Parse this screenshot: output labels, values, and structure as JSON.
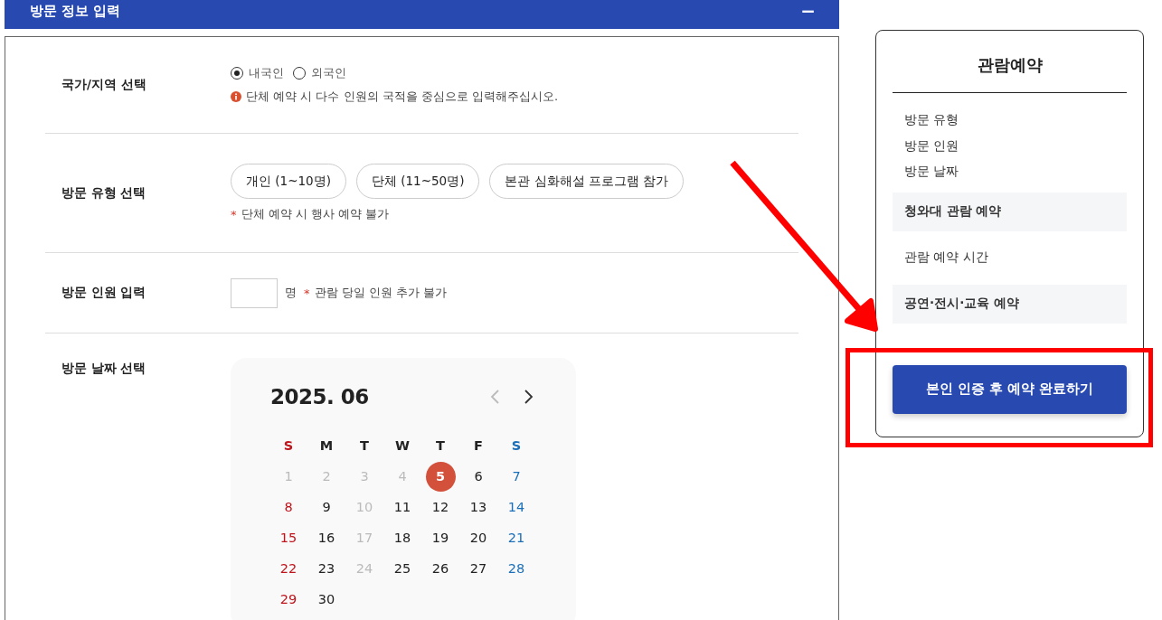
{
  "section": {
    "title": "방문 정보 입력",
    "collapse_icon": "−"
  },
  "form": {
    "rows": [
      {
        "kind": "radio",
        "label": "국가/지역 선택",
        "options": [
          {
            "label": "내국인",
            "selected": true
          },
          {
            "label": "외국인",
            "selected": false
          }
        ],
        "note": "단체 예약 시 다수 인원의 국적을 중심으로 입력해주십시오."
      },
      {
        "kind": "chips",
        "label": "방문 유형 선택",
        "options": [
          {
            "label": "개인 (1~10명)",
            "selected": false
          },
          {
            "label": "단체 (11~50명)",
            "selected": false
          },
          {
            "label": "본관 심화해설 프로그램 참가",
            "selected": false
          }
        ],
        "note_mark": "*",
        "note": "단체 예약 시 행사 예약 불가"
      },
      {
        "kind": "count",
        "label": "방문 인원 입력",
        "unit": "명",
        "note_mark": "*",
        "note": "관람 당일 인원 추가 불가"
      },
      {
        "kind": "calendar",
        "label": "방문 날짜 선택"
      }
    ]
  },
  "calendar": {
    "month": "2025. 06",
    "weekdays": [
      {
        "label": "S",
        "kind": "sun"
      },
      {
        "label": "M",
        "kind": "normal"
      },
      {
        "label": "T",
        "kind": "normal"
      },
      {
        "label": "W",
        "kind": "normal"
      },
      {
        "label": "T",
        "kind": "normal"
      },
      {
        "label": "F",
        "kind": "normal"
      },
      {
        "label": "S",
        "kind": "sat"
      }
    ],
    "weeks": [
      [
        {
          "day": "1",
          "kind": "disabled",
          "selected": false
        },
        {
          "day": "2",
          "kind": "disabled",
          "selected": false
        },
        {
          "day": "3",
          "kind": "disabled",
          "selected": false
        },
        {
          "day": "4",
          "kind": "disabled",
          "selected": false
        },
        {
          "day": "5",
          "kind": "normal",
          "selected": true
        },
        {
          "day": "6",
          "kind": "normal",
          "selected": false
        },
        {
          "day": "7",
          "kind": "sat",
          "selected": false
        }
      ],
      [
        {
          "day": "8",
          "kind": "sun",
          "selected": false
        },
        {
          "day": "9",
          "kind": "normal",
          "selected": false
        },
        {
          "day": "10",
          "kind": "disabled",
          "selected": false
        },
        {
          "day": "11",
          "kind": "normal",
          "selected": false
        },
        {
          "day": "12",
          "kind": "normal",
          "selected": false
        },
        {
          "day": "13",
          "kind": "normal",
          "selected": false
        },
        {
          "day": "14",
          "kind": "sat",
          "selected": false
        }
      ],
      [
        {
          "day": "15",
          "kind": "sun",
          "selected": false
        },
        {
          "day": "16",
          "kind": "normal",
          "selected": false
        },
        {
          "day": "17",
          "kind": "disabled",
          "selected": false
        },
        {
          "day": "18",
          "kind": "normal",
          "selected": false
        },
        {
          "day": "19",
          "kind": "normal",
          "selected": false
        },
        {
          "day": "20",
          "kind": "normal",
          "selected": false
        },
        {
          "day": "21",
          "kind": "sat",
          "selected": false
        }
      ],
      [
        {
          "day": "22",
          "kind": "sun",
          "selected": false
        },
        {
          "day": "23",
          "kind": "normal",
          "selected": false
        },
        {
          "day": "24",
          "kind": "disabled",
          "selected": false
        },
        {
          "day": "25",
          "kind": "normal",
          "selected": false
        },
        {
          "day": "26",
          "kind": "normal",
          "selected": false
        },
        {
          "day": "27",
          "kind": "normal",
          "selected": false
        },
        {
          "day": "28",
          "kind": "sat",
          "selected": false
        }
      ],
      [
        {
          "day": "29",
          "kind": "sun",
          "selected": false
        },
        {
          "day": "30",
          "kind": "normal",
          "selected": false
        }
      ]
    ]
  },
  "summary": {
    "title": "관람예약",
    "items": [
      {
        "label": "방문 유형",
        "kind": "step"
      },
      {
        "label": "방문 인원",
        "kind": "step"
      },
      {
        "label": "방문 날짜",
        "kind": "step"
      },
      {
        "label": "청와대 관람 예약",
        "kind": "shaded"
      },
      {
        "label": "관람 예약 시간",
        "kind": "plain"
      },
      {
        "label": "공연·전시·교육 예약",
        "kind": "shaded"
      }
    ],
    "button": "본인 인증 후 예약 완료하기"
  }
}
